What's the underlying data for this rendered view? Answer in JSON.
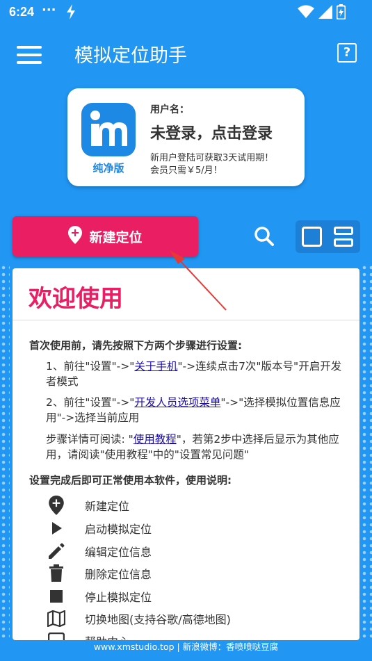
{
  "status_bar": {
    "time": "6:24",
    "dots": "···"
  },
  "app_bar": {
    "title": "模拟定位助手"
  },
  "user_card": {
    "logo_label": "纯净版",
    "username_label": "用户名：",
    "login_prompt": "未登录，点击登录",
    "promo_line1": "新用户登陆可获取3天试用期！",
    "promo_line2": "会员只需￥5/月！"
  },
  "actions": {
    "new_location": "新建定位"
  },
  "welcome": {
    "title": "欢迎使用",
    "intro": "首次使用前，请先按照下方两个步骤进行设置:",
    "step1": {
      "pre": "1、前往\"设置\"->\"",
      "link": "关于手机",
      "post": "\"->连续点击7次\"版本号\"开启开发者模式"
    },
    "step2": {
      "pre": "2、前往\"设置\"->\"",
      "link": "开发人员选项菜单",
      "post": "\"->\"选择模拟位置信息应用\"->选择当前应用"
    },
    "step3": {
      "pre": "步骤详情可阅读: \"",
      "link": "使用教程",
      "post": "\"，若第2步中选择后显示为其他应用，请阅读\"使用教程\"中的\"设置常见问题\""
    },
    "usage_title": "设置完成后即可正常使用本软件，使用说明:",
    "usage_items": [
      {
        "icon": "add-location-icon",
        "label": "新建定位"
      },
      {
        "icon": "play-icon",
        "label": "启动模拟定位"
      },
      {
        "icon": "pencil-icon",
        "label": "编辑定位信息"
      },
      {
        "icon": "trash-icon",
        "label": "删除定位信息"
      },
      {
        "icon": "stop-icon",
        "label": "停止模拟定位"
      },
      {
        "icon": "map-icon",
        "label": "切换地图(支持谷歌/高德地图)"
      },
      {
        "icon": "help-center-icon",
        "label": "帮助中心"
      }
    ]
  },
  "footer": {
    "text": "www.xmstudio.top | 新浪微博：香喷喷哒豆腐"
  },
  "colors": {
    "primary": "#2196f3",
    "accent": "#e91e63",
    "link": "#1a0dab"
  }
}
